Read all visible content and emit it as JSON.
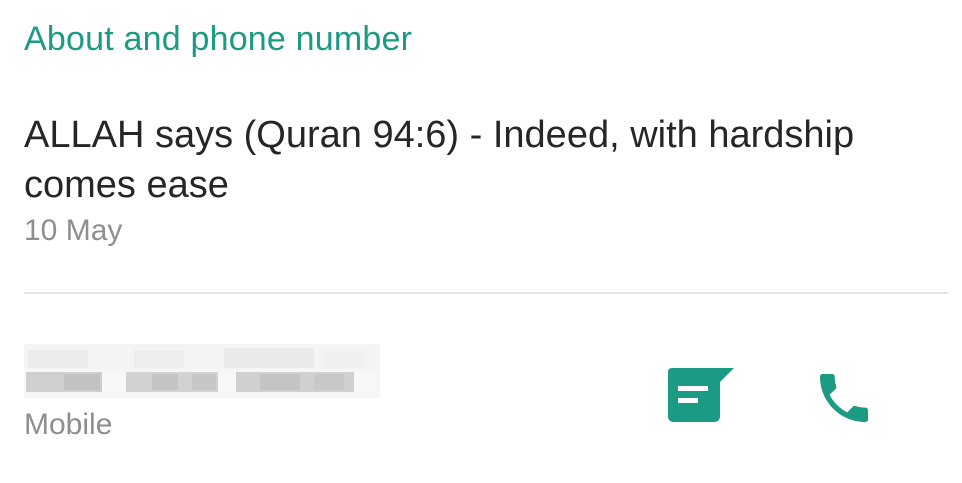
{
  "section": {
    "title": "About and phone number"
  },
  "about": {
    "text": "ALLAH says (Quran 94:6) - Indeed, with hardship comes ease",
    "date": "10 May"
  },
  "phone": {
    "number_obscured": true,
    "type": "Mobile"
  },
  "actions": [
    {
      "name": "message",
      "icon": "message-icon"
    },
    {
      "name": "call",
      "icon": "phone-icon"
    }
  ],
  "colors": {
    "accent": "#1b9a84",
    "primary_text": "#262626",
    "secondary_text": "#8e8e8e",
    "divider": "#e4e4e4"
  }
}
